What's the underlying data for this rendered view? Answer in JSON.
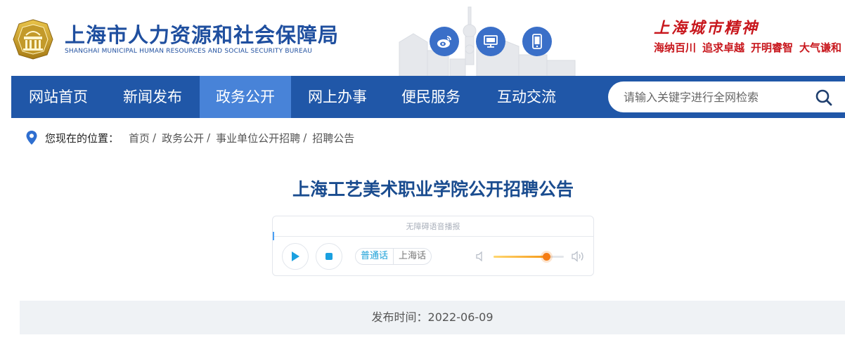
{
  "header": {
    "title_cn": "上海市人力资源和社会保障局",
    "title_en": "SHANGHAI MUNICIPAL HUMAN RESOURCES AND SOCIAL SECURITY BUREAU",
    "spirit_title": "上海城市精神",
    "spirit_phrases": [
      "海纳百川",
      "追求卓越",
      "开明睿智",
      "大气谦和"
    ],
    "icons": [
      "weibo-icon",
      "desktop-icon",
      "mobile-icon"
    ]
  },
  "nav": {
    "items": [
      {
        "label": "网站首页"
      },
      {
        "label": "新闻发布"
      },
      {
        "label": "政务公开",
        "active": true
      },
      {
        "label": "网上办事"
      },
      {
        "label": "便民服务"
      },
      {
        "label": "互动交流"
      }
    ],
    "search_placeholder": "请输入关键字进行全网检索"
  },
  "breadcrumb": {
    "label": "您现在的位置：",
    "items": [
      "首页",
      "政务公开",
      "事业单位公开招聘",
      "招聘公告"
    ],
    "separator": "/"
  },
  "article": {
    "title": "上海工艺美术职业学院公开招聘公告",
    "publish_label": "发布时间：",
    "publish_date": "2022-06-09"
  },
  "player": {
    "header": "无障碍语音播报",
    "lang_on": "普通话",
    "lang_off": "上海话",
    "volume": 0.75
  },
  "colors": {
    "brand_blue": "#2057a8",
    "nav_active": "#4883d8",
    "spirit_red": "#c8171d",
    "title_blue": "#1a4c8f"
  }
}
